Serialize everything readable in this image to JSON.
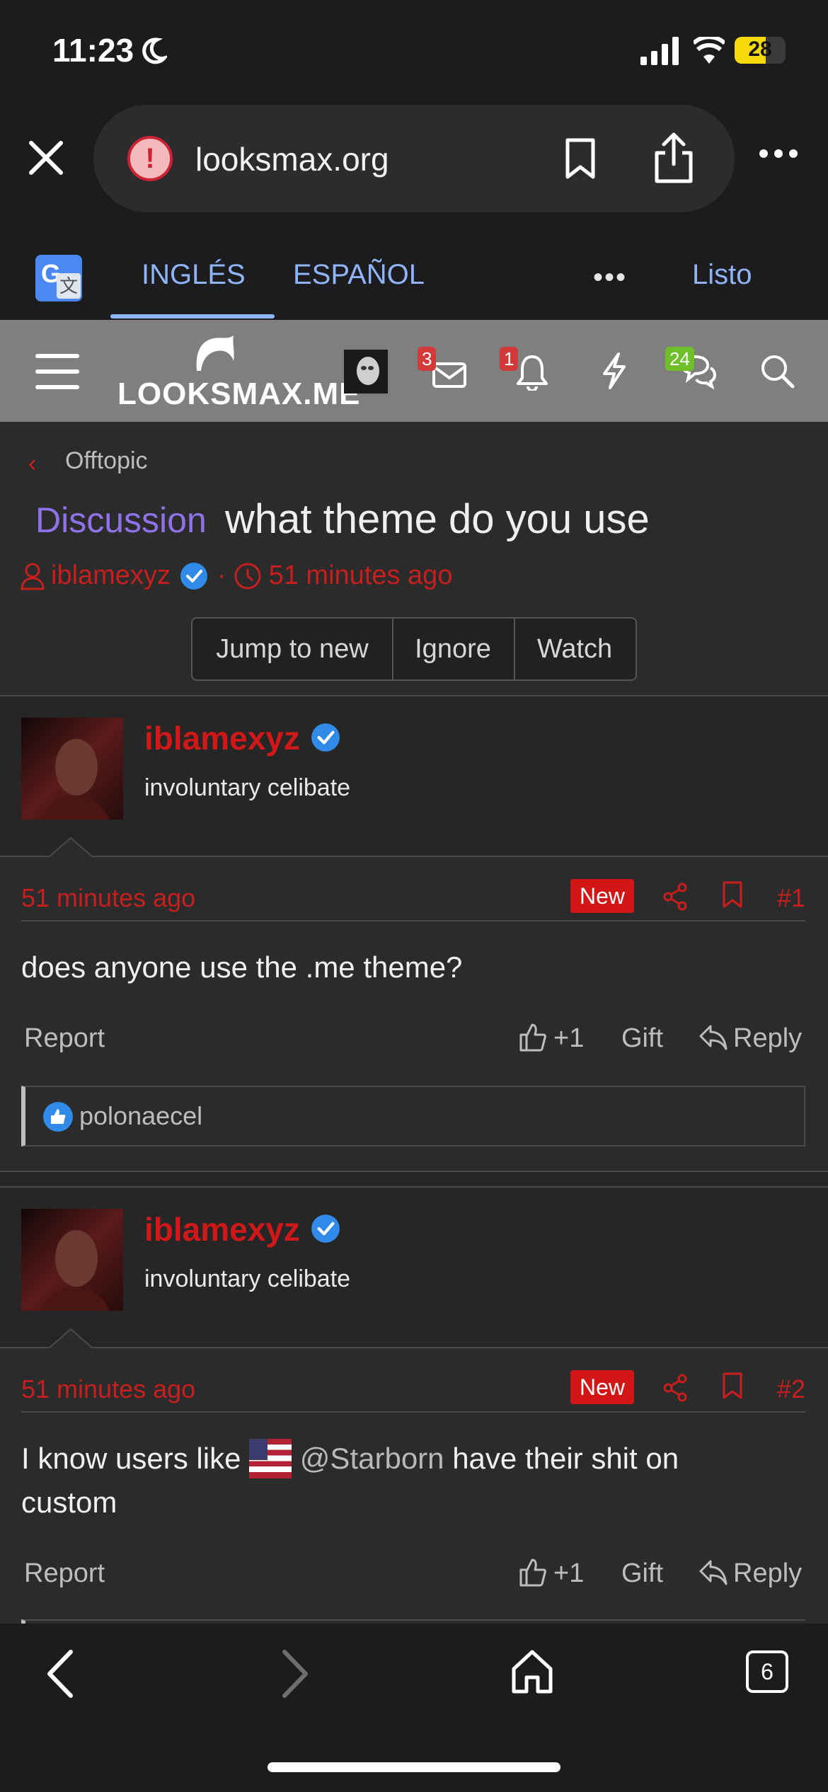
{
  "status": {
    "time": "11:23",
    "battery": "28"
  },
  "browser": {
    "url": "looksmax.org"
  },
  "translate": {
    "from_lang": "INGLÉS",
    "to_lang": "ESPAÑOL",
    "done": "Listo"
  },
  "site": {
    "logo": "LOOKSMAX.ME",
    "badges": {
      "inbox": "3",
      "alerts": "1",
      "chats": "24"
    }
  },
  "thread": {
    "breadcrumb": "Offtopic",
    "prefix": "Discussion",
    "title": "what theme do you use",
    "author": "iblamexyz",
    "started": "51 minutes ago",
    "actions": [
      "Jump to new",
      "Ignore",
      "Watch"
    ]
  },
  "posts": [
    {
      "username": "iblamexyz",
      "user_title": "involuntary celibate",
      "time": "51 minutes ago",
      "new_label": "New",
      "number": "#1",
      "body": "does anyone use the .me theme?",
      "report": "Report",
      "like": "+1",
      "gift": "Gift",
      "reply": "Reply",
      "liked_by": "polonaecel"
    },
    {
      "username": "iblamexyz",
      "user_title": "involuntary celibate",
      "time": "51 minutes ago",
      "new_label": "New",
      "number": "#2",
      "body_before": "I know users like",
      "mention": "@Starborn",
      "body_after": "have their shit on",
      "body_line2": "custom",
      "report": "Report",
      "like": "+1",
      "gift": "Gift",
      "reply": "Reply"
    }
  ],
  "bottom": {
    "tabs": "6"
  },
  "colors": {
    "accent_red": "#c81e1e",
    "prefix_purple": "#8f72e8",
    "link_blue": "#8fb4f8"
  }
}
